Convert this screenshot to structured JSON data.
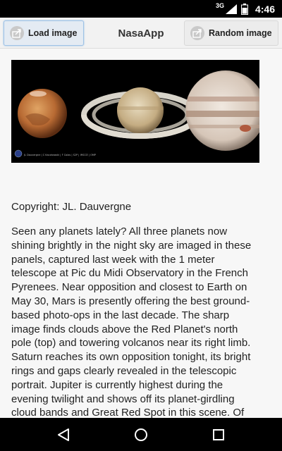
{
  "status_bar": {
    "network": "3G",
    "time": "4:46"
  },
  "toolbar": {
    "load_button": "Load image",
    "title": "NasaApp",
    "random_button": "Random image"
  },
  "apod": {
    "image_icons": [
      "picture-icon"
    ],
    "image_credit": "JL Dauvergne | C Kaczkowski | F Colas | S2P | IMCCE | OMP",
    "copyright": "Copyright: JL. Dauvergne",
    "explanation": "Seen any planets lately? All three planets now shining brightly in the night sky are imaged in these panels, captured last week with the 1 meter telescope at Pic du Midi Observatory in the French Pyrenees. Near opposition and closest to Earth on May 30, Mars is presently offering the best ground-based photo-ops in the last decade. The sharp image finds clouds above the Red Planet's north pole (top) and towering volcanos near its right limb. Saturn reaches its own opposition tonight, its bright rings and gaps clearly revealed in the telescopic portrait. Jupiter is currently highest during the evening twilight and shows off its planet-girdling cloud bands and Great Red Spot in this scene. Of course, all three planets are easy to see with the unaided eye."
  },
  "nav_bar": {
    "icons": [
      "back-icon",
      "home-icon",
      "recents-icon"
    ]
  }
}
